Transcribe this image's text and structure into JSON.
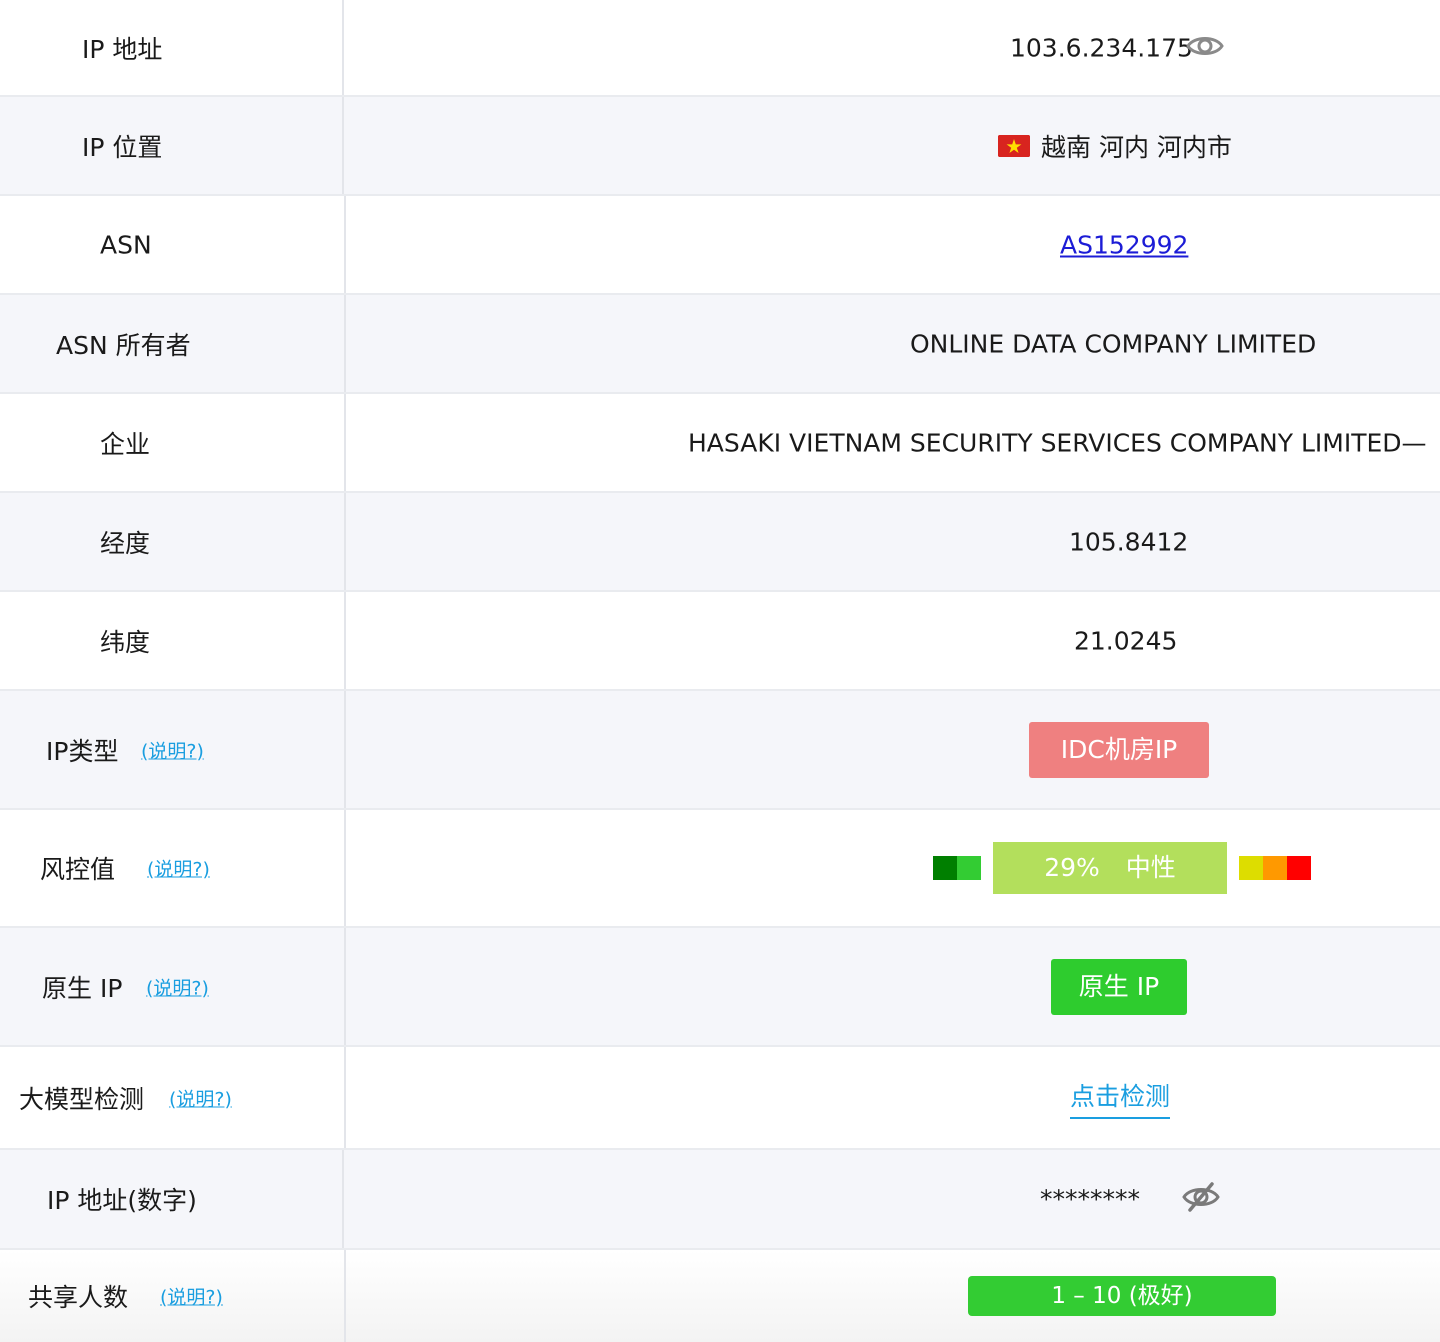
{
  "rows": {
    "ip": {
      "label": "IP 地址",
      "value": "103.6.234.175"
    },
    "location": {
      "label": "IP 位置",
      "value": "越南 河内 河内市",
      "flag": "vietnam-flag"
    },
    "asn": {
      "label": "ASN",
      "value": "AS152992"
    },
    "asn_owner": {
      "label": "ASN 所有者",
      "value": "ONLINE DATA COMPANY LIMITED"
    },
    "company": {
      "label": "企业",
      "value": "HASAKI VIETNAM SECURITY SERVICES COMPANY LIMITED—"
    },
    "longitude": {
      "label": "经度",
      "value": "105.8412"
    },
    "latitude": {
      "label": "纬度",
      "value": "21.0245"
    },
    "ip_type": {
      "label": "IP类型",
      "help": "(说明?)",
      "badge": "IDC机房IP"
    },
    "risk": {
      "label": "风控值",
      "help": "(说明?)",
      "badge": "29% 中性",
      "percent": 29
    },
    "native": {
      "label": "原生 IP",
      "help": "(说明?)",
      "badge": "原生 IP"
    },
    "llm": {
      "label": "大模型检测",
      "help": "(说明?)",
      "link": "点击检测"
    },
    "ip_numeric": {
      "label": "IP 地址(数字)",
      "value": "********"
    },
    "shared": {
      "label": "共享人数",
      "help": "(说明?)",
      "badge": "1 – 10 (极好)"
    }
  },
  "colors": {
    "help_link": "#1a9ee0",
    "asn_link": "#1c1cd6",
    "idc_badge": "#ef8080",
    "native_badge": "#2ecc2e",
    "share_badge": "#33cc33",
    "risk_main": "#b3df5c",
    "risk_scale": [
      "#007f00",
      "#33cc33",
      "#dddd00",
      "#ff9900",
      "#ff0000"
    ]
  }
}
